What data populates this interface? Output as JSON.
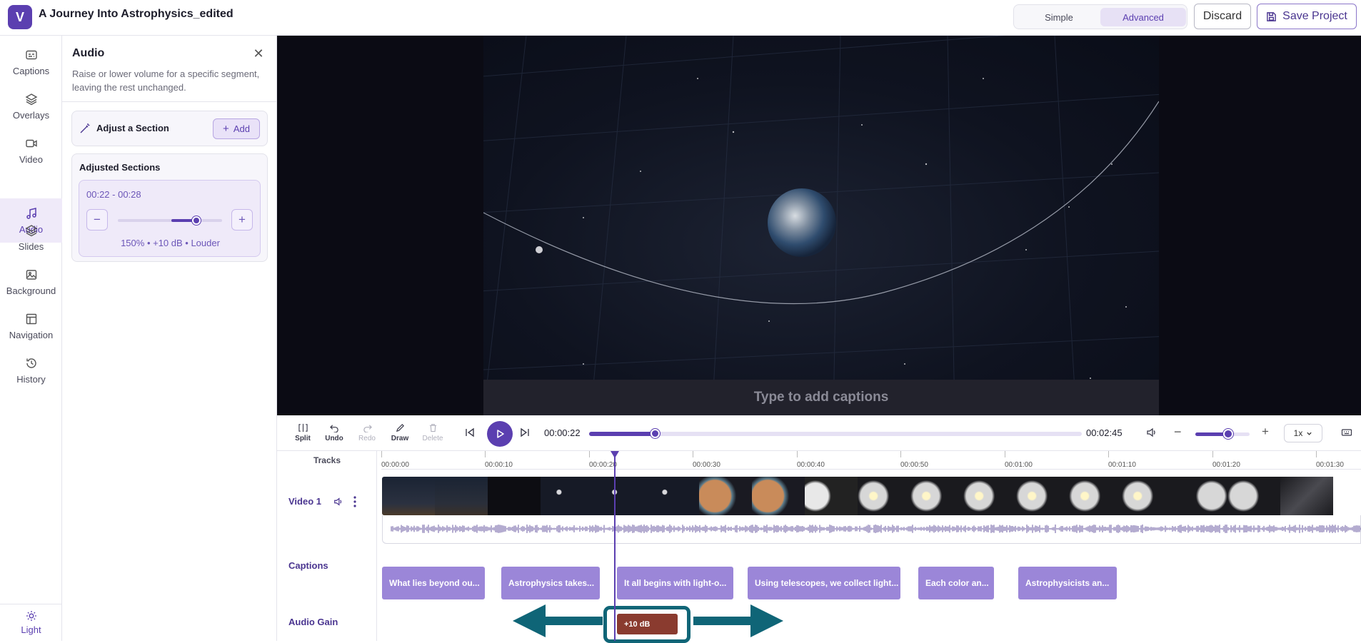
{
  "app": {
    "logo_letter": "V",
    "project_title": "A Journey Into Astrophysics_edited",
    "mode_simple": "Simple",
    "mode_advanced": "Advanced",
    "active_mode": "Advanced",
    "discard_label": "Discard",
    "save_label": "Save Project",
    "accent_color": "#5b3fb0"
  },
  "sidebar": {
    "items": [
      {
        "label": "Captions",
        "icon": "captions-icon"
      },
      {
        "label": "Overlays",
        "icon": "layers-icon"
      },
      {
        "label": "Video",
        "icon": "video-camera-icon"
      },
      {
        "label": "Audio",
        "icon": "music-note-icon",
        "active": true
      },
      {
        "label": "Slides",
        "icon": "slides-icon"
      },
      {
        "label": "Background",
        "icon": "image-icon"
      },
      {
        "label": "Navigation",
        "icon": "layout-icon"
      },
      {
        "label": "History",
        "icon": "history-icon"
      }
    ],
    "theme_label": "Light"
  },
  "panel": {
    "title": "Audio",
    "description": "Raise or lower volume for a specific segment, leaving the rest unchanged.",
    "adjust_label": "Adjust a Section",
    "add_label": "Add",
    "adjusted_title": "Adjusted Sections",
    "segment": {
      "time_range": "00:22 - 00:28",
      "level": 0.75,
      "info": "150% • +10 dB • Louder"
    }
  },
  "preview": {
    "caption_placeholder": "Type to add captions"
  },
  "controls": {
    "tools": [
      {
        "label": "Split",
        "icon": "split-icon",
        "enabled": true
      },
      {
        "label": "Undo",
        "icon": "undo-icon",
        "enabled": true
      },
      {
        "label": "Redo",
        "icon": "redo-icon",
        "enabled": false
      },
      {
        "label": "Draw",
        "icon": "pencil-icon",
        "enabled": true
      },
      {
        "label": "Delete",
        "icon": "trash-icon",
        "enabled": false
      }
    ],
    "current_time": "00:00:22",
    "total_time": "00:02:45",
    "progress": 0.133,
    "volume": 0.6,
    "speed": "1x"
  },
  "timeline": {
    "tracks_label": "Tracks",
    "ticks": [
      "00:00:00",
      "00:00:10",
      "00:00:20",
      "00:00:30",
      "00:00:40",
      "00:00:50",
      "00:01:00",
      "00:01:10",
      "00:01:20",
      "00:01:30"
    ],
    "video_track_label": "Video 1",
    "captions_track_label": "Captions",
    "audio_gain_label": "Audio Gain",
    "captions": [
      "What lies beyond ou...",
      "Astrophysics takes...",
      "It all begins with light-o...",
      "Using telescopes, we collect light...",
      "Each color an...",
      "Astrophysicists an..."
    ],
    "gain_chip_label": "+10 dB",
    "highlight_color": "#0f6577",
    "gain_chip_color": "#8a3b2f"
  }
}
